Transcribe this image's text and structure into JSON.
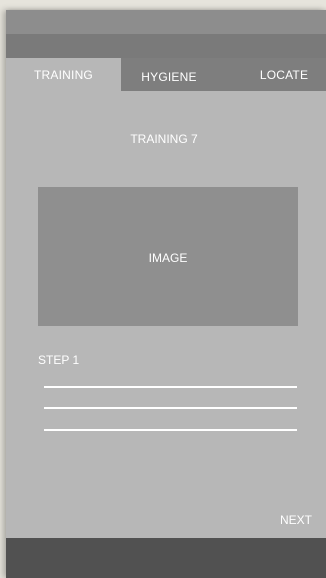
{
  "tabs": [
    {
      "label": "TRAINING",
      "active": true
    },
    {
      "label": "HYGIENE",
      "active": false
    },
    {
      "label": "LOCATE",
      "active": false
    }
  ],
  "content": {
    "title": "TRAINING 7",
    "image_placeholder": "IMAGE",
    "step_label": "STEP 1"
  },
  "actions": {
    "next_label": "NEXT"
  }
}
